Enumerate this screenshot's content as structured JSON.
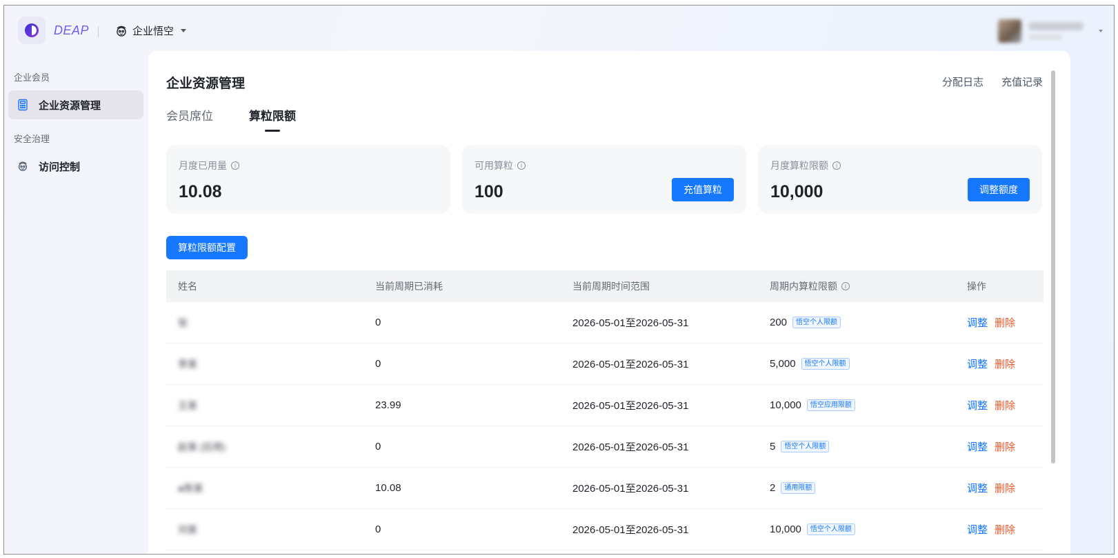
{
  "header": {
    "logo_text": "DEAP",
    "app_name": "企业悟空"
  },
  "sidebar": {
    "group1": "企业会员",
    "item_resource": "企业资源管理",
    "group2": "安全治理",
    "item_access": "访问控制"
  },
  "main": {
    "title": "企业资源管理",
    "link_log": "分配日志",
    "link_recharge": "充值记录",
    "tabs": [
      {
        "label": "会员席位"
      },
      {
        "label": "算粒限额"
      }
    ]
  },
  "cards": [
    {
      "label": "月度已用量",
      "value": "10.08"
    },
    {
      "label": "可用算粒",
      "value": "100",
      "button": "充值算粒"
    },
    {
      "label": "月度算粒限额",
      "value": "10,000",
      "button": "调整额度"
    }
  ],
  "config_button": "算粒限额配置",
  "table": {
    "headers": [
      "姓名",
      "当前周期已消耗",
      "当前周期时间范围",
      "周期内算粒限额",
      "操作"
    ],
    "adjust_label": "调整",
    "delete_label": "删除",
    "rows": [
      {
        "name": "张",
        "consumed": "0",
        "range": "2026-05-01至2026-05-31",
        "limit": "200",
        "tag": "悟空个人限额"
      },
      {
        "name": "李某",
        "consumed": "0",
        "range": "2026-05-01至2026-05-31",
        "limit": "5,000",
        "tag": "悟空个人限额"
      },
      {
        "name": "王某",
        "consumed": "23.99",
        "range": "2026-05-01至2026-05-31",
        "limit": "10,000",
        "tag": "悟空应用限额"
      },
      {
        "name": "赵某 (应用)",
        "consumed": "0",
        "range": "2026-05-01至2026-05-31",
        "limit": "5",
        "tag": "悟空个人限额"
      },
      {
        "name": "●陈某",
        "consumed": "10.08",
        "range": "2026-05-01至2026-05-31",
        "limit": "2",
        "tag": "通用限额"
      },
      {
        "name": "刘某",
        "consumed": "0",
        "range": "2026-05-01至2026-05-31",
        "limit": "10,000",
        "tag": "悟空个人限额"
      }
    ]
  },
  "colors": {
    "accent": "#1677ff",
    "danger": "#f5582c",
    "logo": "#6a5ef0"
  }
}
